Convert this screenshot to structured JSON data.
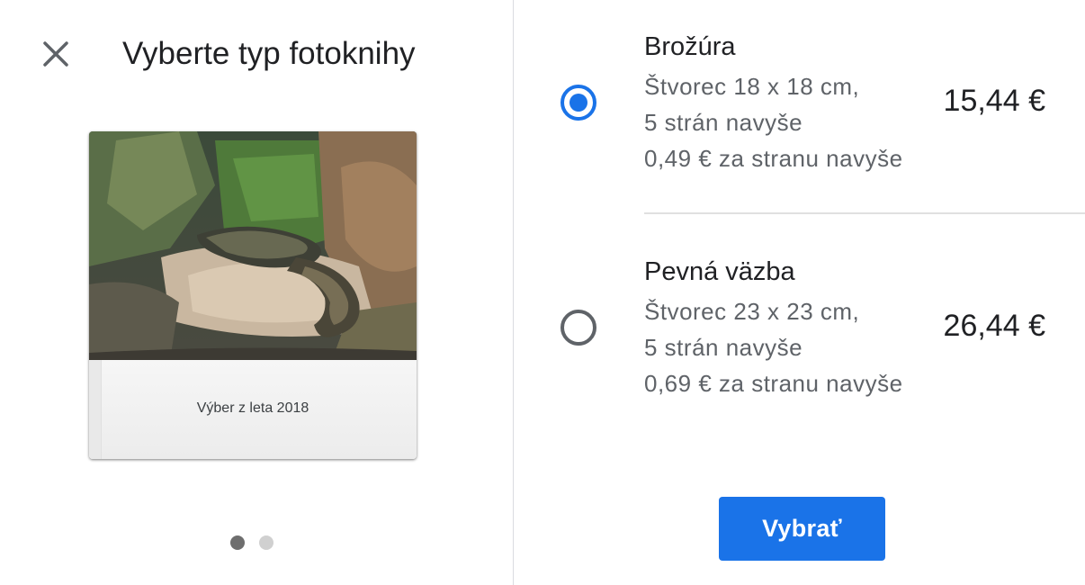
{
  "dialog": {
    "title": "Vyberte typ fotoknihy",
    "close_icon": "close-icon"
  },
  "preview": {
    "caption": "Výber z leta 2018",
    "pages_total": 2,
    "active_page": 1
  },
  "options": [
    {
      "name": "Brožúra",
      "size": "Štvorec 18 x 18 cm,",
      "extra_pages": "5 strán navyše",
      "per_page": "0,49 € za stranu navyše",
      "price": "15,44 €",
      "selected": true
    },
    {
      "name": "Pevná väzba",
      "size": "Štvorec 23 x 23 cm,",
      "extra_pages": "5 strán navyše",
      "per_page": "0,69 € za stranu navyše",
      "price": "26,44 €",
      "selected": false
    }
  ],
  "actions": {
    "select_label": "Vybrať"
  },
  "colors": {
    "accent": "#1a73e8",
    "text_primary": "#202124",
    "text_secondary": "#5f6368"
  }
}
